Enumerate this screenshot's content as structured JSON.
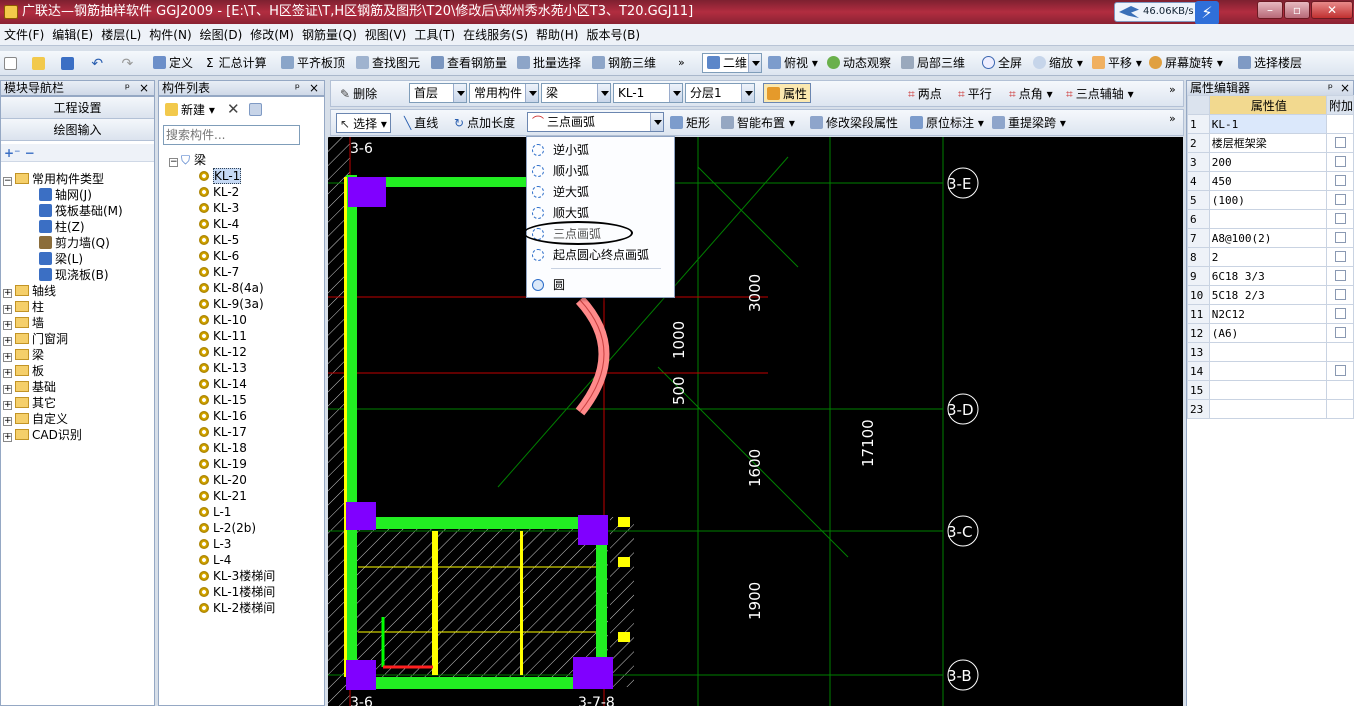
{
  "window": {
    "title": "广联达—钢筋抽样软件 GGJ2009 - [E:\\T、H区签证\\T,H区钢筋及图形\\T20\\修改后\\郑州秀水苑小区T3、T20.GGJ11]",
    "net_speed": "46.06KB/s"
  },
  "menu": [
    "文件(F)",
    "编辑(E)",
    "楼层(L)",
    "构件(N)",
    "绘图(D)",
    "修改(M)",
    "钢筋量(Q)",
    "视图(V)",
    "工具(T)",
    "在线服务(S)",
    "帮助(H)",
    "版本号(B)"
  ],
  "toolbar1": {
    "define": "定义",
    "sum": "汇总计算",
    "flat_top": "平齐板顶",
    "find": "查找图元",
    "view_rebar": "查看钢筋量",
    "batch_select": "批量选择",
    "rebar_3d": "钢筋三维",
    "view_mode": "二维",
    "top_view": "俯视",
    "dynamic": "动态观察",
    "local_3d": "局部三维",
    "fullscreen": "全屏",
    "zoom": "缩放",
    "pan": "平移",
    "rotate": "屏幕旋转",
    "select_floor": "选择楼层"
  },
  "nav": {
    "header": "模块导航栏",
    "project_settings": "工程设置",
    "draw_input": "绘图输入",
    "common_group": "常用构件类型",
    "common_items": [
      "轴网(J)",
      "筏板基础(M)",
      "柱(Z)",
      "剪力墙(Q)",
      "梁(L)",
      "现浇板(B)"
    ],
    "groups": [
      "轴线",
      "柱",
      "墙",
      "门窗洞",
      "梁",
      "板",
      "基础",
      "其它",
      "自定义",
      "CAD识别"
    ]
  },
  "component_list": {
    "header": "构件列表",
    "new_label": "新建",
    "search_placeholder": "搜索构件...",
    "root": "梁",
    "items": [
      "KL-1",
      "KL-2",
      "KL-3",
      "KL-4",
      "KL-5",
      "KL-6",
      "KL-7",
      "KL-8(4a)",
      "KL-9(3a)",
      "KL-10",
      "KL-11",
      "KL-12",
      "KL-13",
      "KL-14",
      "KL-15",
      "KL-16",
      "KL-17",
      "KL-18",
      "KL-19",
      "KL-20",
      "KL-21",
      "L-1",
      "L-2(2b)",
      "L-3",
      "L-4",
      "KL-3楼梯间",
      "KL-1楼梯间",
      "KL-2楼梯间"
    ],
    "selected": "KL-1"
  },
  "toolbar2": {
    "delete": "删除",
    "floor": "首层",
    "category": "常用构件",
    "type": "梁",
    "component": "KL-1",
    "layer": "分层1",
    "attr": "属性",
    "two_points": "两点",
    "parallel": "平行",
    "point_angle": "点角",
    "three_point_aux": "三点辅轴"
  },
  "toolbar3": {
    "select": "选择",
    "line": "直线",
    "point_length": "点加长度",
    "arc_mode": "三点画弧",
    "rect": "矩形",
    "smart_layout": "智能布置",
    "modify_span": "修改梁段属性",
    "in_situ": "原位标注",
    "re_extract": "重提梁跨"
  },
  "arc_menu": {
    "items": [
      "逆小弧",
      "顺小弧",
      "逆大弧",
      "顺大弧",
      "三点画弧",
      "起点圆心终点画弧"
    ],
    "circle": "圆",
    "selected": "三点画弧"
  },
  "canvas": {
    "axes": [
      "3-E",
      "3-D",
      "3-C",
      "3-B"
    ],
    "bottom_axes": [
      "3-6",
      "3-7-8"
    ],
    "top_axis": "3-6",
    "dims": [
      "3000",
      "1000",
      "500",
      "1600",
      "1900",
      "17100"
    ]
  },
  "properties": {
    "header": "属性编辑器",
    "col_value": "属性值",
    "col_extra": "附加",
    "rows": [
      {
        "n": "1",
        "v": "KL-1",
        "cb": false
      },
      {
        "n": "2",
        "v": "楼层框架梁",
        "cb": true
      },
      {
        "n": "3",
        "v": "200",
        "cb": true
      },
      {
        "n": "4",
        "v": "450",
        "cb": true
      },
      {
        "n": "5",
        "v": "(100)",
        "cb": true
      },
      {
        "n": "6",
        "v": "",
        "cb": true
      },
      {
        "n": "7",
        "v": "A8@100(2)",
        "cb": true
      },
      {
        "n": "8",
        "v": "2",
        "cb": true
      },
      {
        "n": "9",
        "v": "6C18 3/3",
        "cb": true
      },
      {
        "n": "10",
        "v": "5C18 2/3",
        "cb": true
      },
      {
        "n": "11",
        "v": "N2C12",
        "cb": true
      },
      {
        "n": "12",
        "v": "(A6)",
        "cb": true
      },
      {
        "n": "13",
        "v": "",
        "cb": false
      },
      {
        "n": "14",
        "v": "",
        "cb": true
      },
      {
        "n": "15",
        "v": "",
        "cb": false
      },
      {
        "n": "23",
        "v": "",
        "cb": false
      }
    ]
  },
  "colors": {
    "canvas": "#000000",
    "beam": "#00ff00",
    "column": "#8000ff",
    "axis": "#ff0000",
    "grid": "#00aa00",
    "arc": "#ff8080"
  }
}
